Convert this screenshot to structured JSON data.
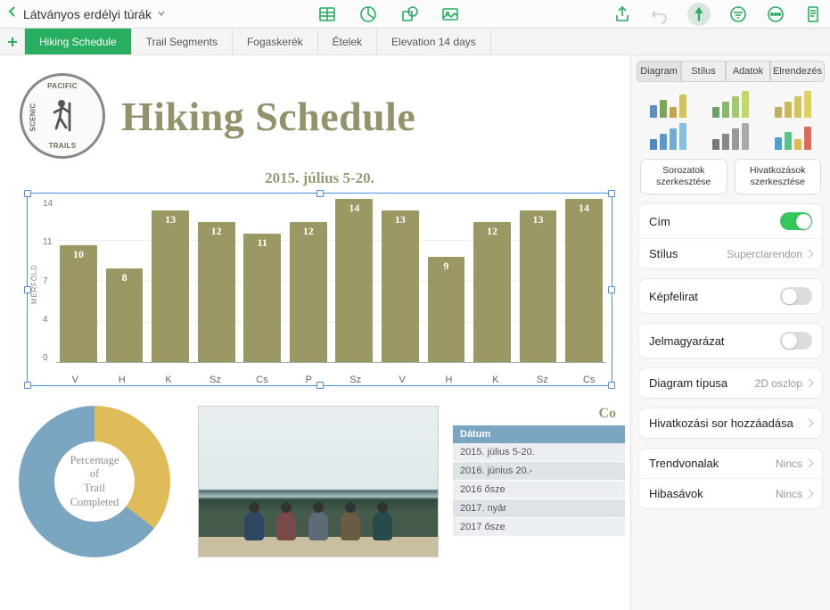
{
  "toolbar": {
    "title": "Látványos erdélyi túrák"
  },
  "sheets": [
    "Hiking Schedule",
    "Trail Segments",
    "Fogaskerék",
    "Ételek",
    "Elevation 14 days"
  ],
  "page": {
    "title": "Hiking Schedule",
    "logo": {
      "top": "PACIFIC",
      "left": "SCENIC",
      "right": "",
      "bottom": "TRAILS"
    }
  },
  "chart_title": "2015. július 5-20.",
  "chart_data": {
    "type": "bar",
    "categories": [
      "V",
      "H",
      "K",
      "Sz",
      "Cs",
      "P",
      "Sz",
      "V",
      "H",
      "K",
      "Sz",
      "Cs"
    ],
    "values": [
      10,
      8,
      13,
      12,
      11,
      12,
      14,
      13,
      9,
      12,
      13,
      14
    ],
    "ylabel": "MÉRFÖLD",
    "yticks": [
      14,
      11,
      7,
      4,
      0
    ],
    "ylim": [
      0,
      14
    ],
    "title": "2015. július 5-20."
  },
  "donut": {
    "label_l1": "Percentage",
    "label_l2": "of",
    "label_l3": "Trail",
    "label_l4": "Completed"
  },
  "table": {
    "title_partial": "Co",
    "header": "Dátum",
    "rows": [
      "2015. július 5-20.",
      "2016. június 20.-",
      "2016 ősze",
      "2017. nyár",
      "2017 ősze"
    ]
  },
  "inspector": {
    "tabs": [
      "Diagram",
      "Stílus",
      "Adatok",
      "Elrendezés"
    ],
    "edit_series": "Sorozatok szerkesztése",
    "edit_refs": "Hivatkozások szerkesztése",
    "title_label": "Cím",
    "style_label": "Stílus",
    "style_value": "Superclarendon",
    "caption_label": "Képfelirat",
    "legend_label": "Jelmagyarázat",
    "type_label": "Diagram típusa",
    "type_value": "2D oszlop",
    "addref_label": "Hivatkozási sor hozzáadása",
    "trend_label": "Trendvonalak",
    "trend_value": "Nincs",
    "error_label": "Hibasávok",
    "error_value": "Nincs"
  }
}
